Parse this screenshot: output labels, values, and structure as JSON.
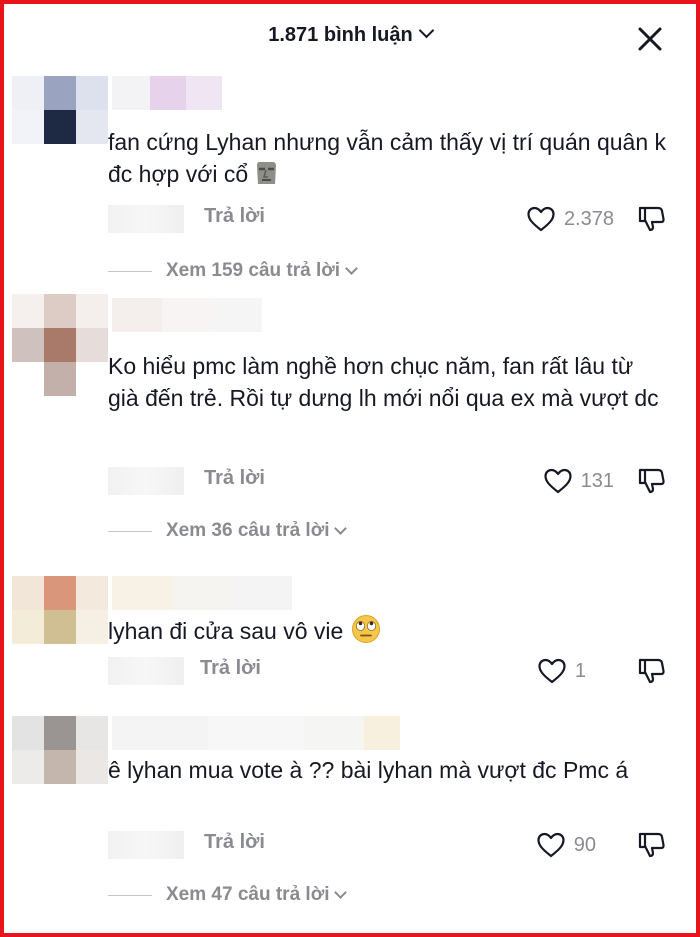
{
  "header": {
    "title": "1.871 bình luận"
  },
  "colors": {
    "frame": "#e8141c",
    "text": "#161823",
    "muted": "#8a8b91"
  },
  "comments": [
    {
      "text": "fan cứng Lyhan nhưng vẫn cảm thấy vị trí quán quân k đc hợp với cổ",
      "emoji": "moai-emoji",
      "reply_label": "Trả lời",
      "likes": "2.378",
      "view_replies": "Xem 159 câu trả lời"
    },
    {
      "text": "Ko hiểu pmc làm nghề hơn chục năm, fan rất lâu từ già đến trẻ. Rồi tự dưng lh mới nổi qua ex mà vượt dc",
      "reply_label": "Trả lời",
      "likes": "131",
      "view_replies": "Xem 36 câu trả lời"
    },
    {
      "text": "lyhan đi cửa sau vô vie",
      "emoji": "eye-roll-emoji",
      "reply_label": "Trả lời",
      "likes": "1"
    },
    {
      "text": "ê lyhan mua vote à ?? bài lyhan mà vượt đc Pmc á",
      "reply_label": "Trả lời",
      "likes": "90",
      "view_replies": "Xem 47 câu trả lời"
    }
  ]
}
